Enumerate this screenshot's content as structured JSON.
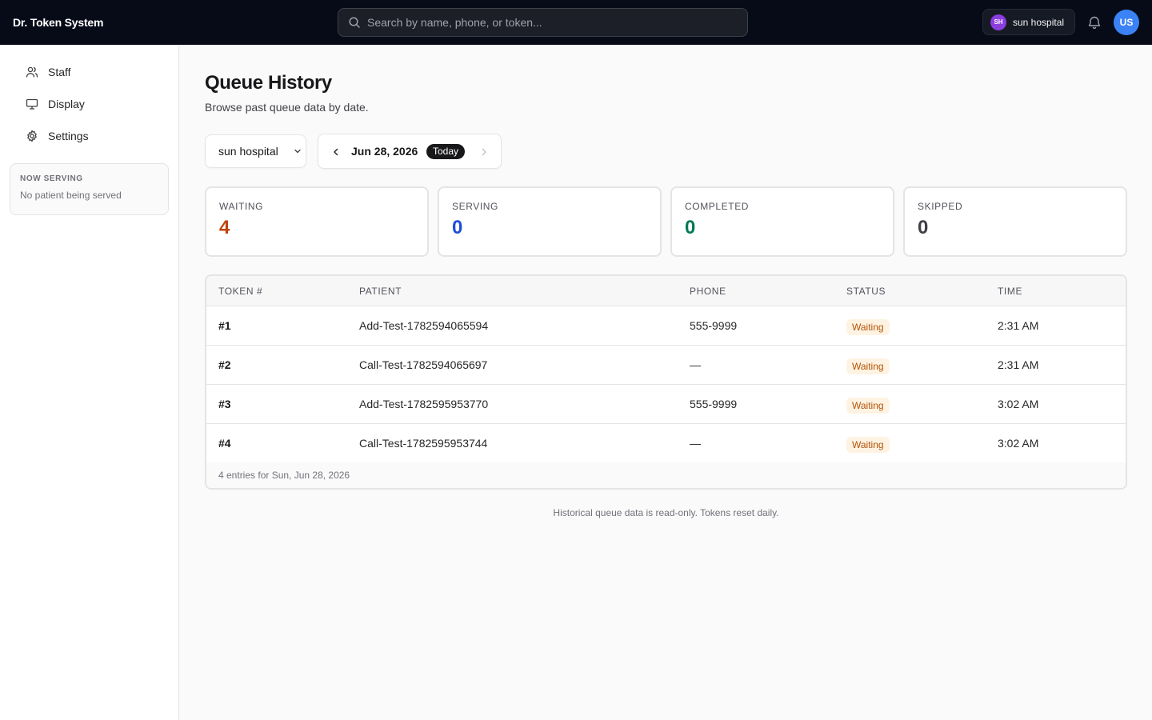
{
  "app": {
    "title": "Dr. Token System"
  },
  "search": {
    "placeholder": "Search by name, phone, or token..."
  },
  "header": {
    "hospital_initials": "SH",
    "hospital_name": "sun hospital",
    "user_initials": "US",
    "hospital_avatar_color": "#8b3dde",
    "user_avatar_color": "#3b82f6"
  },
  "sidebar": {
    "items": [
      {
        "label": "Staff",
        "icon": "users-icon"
      },
      {
        "label": "Display",
        "icon": "monitor-icon"
      },
      {
        "label": "Settings",
        "icon": "gear-icon"
      }
    ],
    "now_serving": {
      "title": "NOW SERVING",
      "message": "No patient being served"
    }
  },
  "page": {
    "title": "Queue History",
    "subtitle": "Browse past queue data by date."
  },
  "filters": {
    "hospital_selected": "sun hospital",
    "date": "Jun 28, 2026",
    "today_badge": "Today"
  },
  "stats": [
    {
      "label": "WAITING",
      "value": "4",
      "color": "#c2410c"
    },
    {
      "label": "SERVING",
      "value": "0",
      "color": "#1d4ed8"
    },
    {
      "label": "COMPLETED",
      "value": "0",
      "color": "#047857"
    },
    {
      "label": "SKIPPED",
      "value": "0",
      "color": "#3f3f46"
    }
  ],
  "table": {
    "headers": [
      "TOKEN #",
      "PATIENT",
      "PHONE",
      "STATUS",
      "TIME"
    ],
    "rows": [
      {
        "token": "#1",
        "patient": "Add-Test-1782594065594",
        "phone": "555-9999",
        "status": "Waiting",
        "time": "2:31 AM"
      },
      {
        "token": "#2",
        "patient": "Call-Test-1782594065697",
        "phone": "—",
        "status": "Waiting",
        "time": "2:31 AM"
      },
      {
        "token": "#3",
        "patient": "Add-Test-1782595953770",
        "phone": "555-9999",
        "status": "Waiting",
        "time": "3:02 AM"
      },
      {
        "token": "#4",
        "patient": "Call-Test-1782595953744",
        "phone": "—",
        "status": "Waiting",
        "time": "3:02 AM"
      }
    ],
    "footer": "4 entries for Sun, Jun 28, 2026"
  },
  "footer_note": "Historical queue data is read-only. Tokens reset daily."
}
